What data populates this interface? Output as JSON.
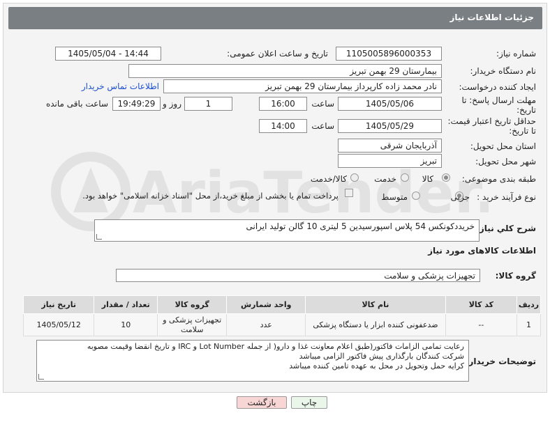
{
  "header": {
    "title": "جزئیات اطلاعات نیاز"
  },
  "form": {
    "need_number_label": "شماره نیاز:",
    "need_number": "1105005896000353",
    "announce_label": "تاریخ و ساعت اعلان عمومی:",
    "announce_value": "1405/05/04 - 14:44",
    "buyer_org_label": "نام دستگاه خریدار:",
    "buyer_org": "بیمارستان 29 بهمن تبریز",
    "requester_label": "ایجاد کننده درخواست:",
    "requester": "نادر محمد زاده کارپرداز بیمارستان 29 بهمن تبریز",
    "contact_link": "اطلاعات تماس خریدار",
    "reply_deadline_label_1": "مهلت ارسال پاسخ: تا",
    "reply_deadline_label_2": "تاریخ:",
    "reply_date": "1405/05/06",
    "time_label": "ساعت",
    "reply_time": "16:00",
    "days_value": "1",
    "days_label": "روز و",
    "remaining_time": "19:49:29",
    "remaining_label": "ساعت باقی مانده",
    "validity_label_1": "حداقل تاریخ اعتبار قیمت:",
    "validity_label_2": "تا تاریخ:",
    "validity_date": "1405/05/29",
    "validity_time": "14:00",
    "province_label": "استان محل تحویل:",
    "province": "آذربایجان شرقی",
    "city_label": "شهر محل تحویل:",
    "city": "تبریز",
    "category_label": "طبقه بندی موضوعی:",
    "category_options": [
      "کالا",
      "خدمت",
      "کالا/خدمت"
    ],
    "category_selected": "کالا",
    "process_label": "نوع فرآیند خرید :",
    "process_options": [
      "جزیی",
      "متوسط"
    ],
    "process_selected": "جزیی",
    "payment_text": "پرداخت تمام یا بخشی از مبلغ خرید،از محل \"اسناد خزانه اسلامی\" خواهد بود.",
    "summary_label": "شرح کلي نياز:",
    "summary": "خریددکونکس 54 پلاس اسپورسیدین 5 لیتری 10 گالن تولید ایرانی",
    "goods_info_label": "اطلاعات کالاهای مورد نیاز",
    "goods_group_label": "گروه کالا:",
    "goods_group": "تجهیزات پزشکی و سلامت"
  },
  "table": {
    "headers": [
      "ردیف",
      "کد کالا",
      "نام کالا",
      "واحد شمارش",
      "گروه کالا",
      "تعداد / مقدار",
      "تاریخ نیاز"
    ],
    "rows": [
      [
        "1",
        "--",
        "ضدعفونی کننده ابزار یا دستگاه پزشکی",
        "عدد",
        "تجهیزات پزشکی و سلامت",
        "10",
        "1405/05/12"
      ]
    ]
  },
  "buyer_notes": {
    "label": "توضیحات خریدار:",
    "lines": [
      "رعایت تمامی الزامات فاکتور(طبق اعلام معاونت غذا و دارو( از جمله Lot Number و IRC و تاریخ انقضا وقیمت مصوبه",
      "شرکت کنندگان بارگذاری پیش فاکتور الزامی میباشد",
      "کرایه حمل وتحویل در محل به عهده تامین کننده میباشد"
    ]
  },
  "buttons": {
    "print": "چاپ",
    "back": "بازگشت"
  },
  "colors": {
    "header_bg": "#7a7f84",
    "back_btn_bg": "#f9d6d6",
    "print_btn_bg": "#eaf6ea",
    "link": "#1a4fd0"
  },
  "watermark": "AriaTender.net"
}
